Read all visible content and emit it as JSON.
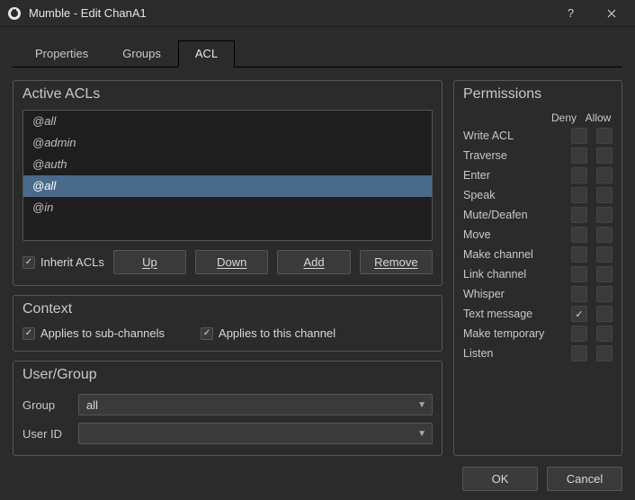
{
  "window": {
    "title": "Mumble - Edit ChanA1"
  },
  "tabs": {
    "properties": "Properties",
    "groups": "Groups",
    "acl": "ACL"
  },
  "acls": {
    "title": "Active ACLs",
    "items": [
      "@all",
      "@admin",
      "@auth",
      "@all",
      "@in"
    ],
    "selected_index": 3,
    "inherit_label": "Inherit ACLs",
    "inherit_checked": true,
    "buttons": {
      "up": "Up",
      "down": "Down",
      "add": "Add",
      "remove": "Remove"
    }
  },
  "context": {
    "title": "Context",
    "sub_label": "Applies to sub-channels",
    "sub_checked": true,
    "this_label": "Applies to this channel",
    "this_checked": true
  },
  "usergroup": {
    "title": "User/Group",
    "group_label": "Group",
    "group_value": "all",
    "user_label": "User ID",
    "user_value": ""
  },
  "permissions": {
    "title": "Permissions",
    "deny_header": "Deny",
    "allow_header": "Allow",
    "rows": [
      {
        "label": "Write ACL",
        "deny": false,
        "allow": false
      },
      {
        "label": "Traverse",
        "deny": false,
        "allow": false
      },
      {
        "label": "Enter",
        "deny": false,
        "allow": false
      },
      {
        "label": "Speak",
        "deny": false,
        "allow": false
      },
      {
        "label": "Mute/Deafen",
        "deny": false,
        "allow": false
      },
      {
        "label": "Move",
        "deny": false,
        "allow": false
      },
      {
        "label": "Make channel",
        "deny": false,
        "allow": false
      },
      {
        "label": "Link channel",
        "deny": false,
        "allow": false
      },
      {
        "label": "Whisper",
        "deny": false,
        "allow": false
      },
      {
        "label": "Text message",
        "deny": true,
        "allow": false
      },
      {
        "label": "Make temporary",
        "deny": false,
        "allow": false
      },
      {
        "label": "Listen",
        "deny": false,
        "allow": false
      }
    ]
  },
  "footer": {
    "ok": "OK",
    "cancel": "Cancel"
  }
}
